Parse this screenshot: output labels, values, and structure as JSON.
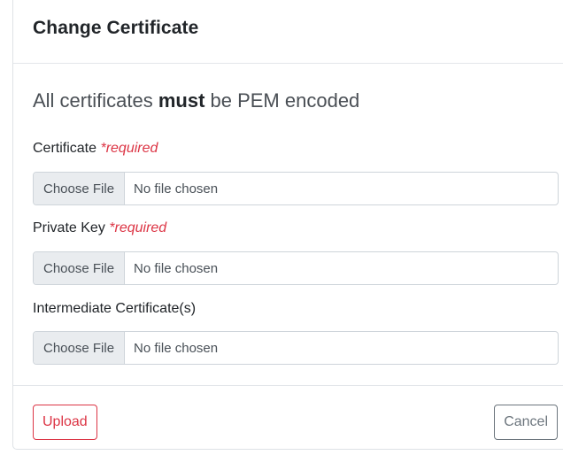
{
  "modal": {
    "title": "Change Certificate"
  },
  "body": {
    "lead_prefix": "All certificates ",
    "lead_emphasis": "must",
    "lead_suffix": " be PEM encoded",
    "fields": [
      {
        "label": "Certificate ",
        "required_text": "*required",
        "button_label": "Choose File",
        "status": "No file chosen"
      },
      {
        "label": "Private Key ",
        "required_text": "*required",
        "button_label": "Choose File",
        "status": "No file chosen"
      },
      {
        "label": "Intermediate Certificate(s)",
        "required_text": "",
        "button_label": "Choose File",
        "status": "No file chosen"
      }
    ]
  },
  "footer": {
    "upload_label": "Upload",
    "cancel_label": "Cancel"
  },
  "colors": {
    "danger": "#dc3545",
    "secondary": "#6c757d",
    "file_button_bg": "#e9ecef"
  }
}
